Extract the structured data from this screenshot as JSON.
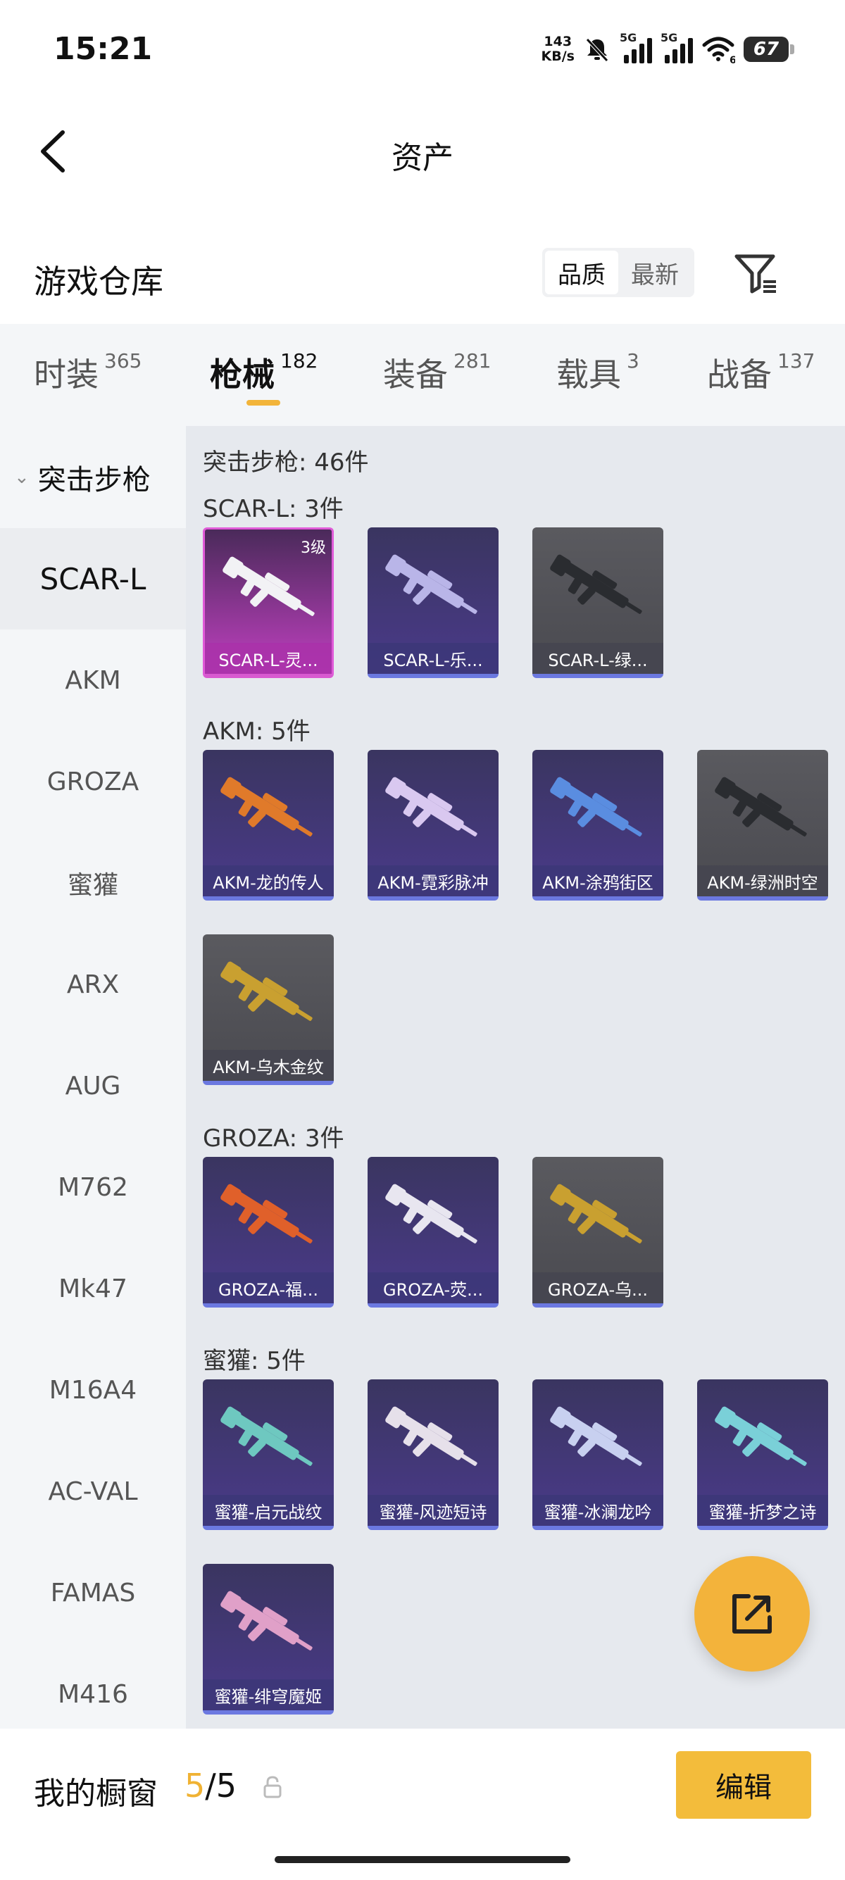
{
  "status_bar": {
    "time": "15:21",
    "net_speed_value": "143",
    "net_speed_unit": "KB/s",
    "signal_1_label": "5G",
    "signal_2_label": "5G",
    "wifi_label": "6",
    "battery": "67"
  },
  "header": {
    "title": "资产"
  },
  "warehouse": {
    "title": "游戏仓库",
    "sort_options": [
      "品质",
      "最新"
    ],
    "active_sort": "品质"
  },
  "tabs": [
    {
      "label": "时装",
      "count": "365"
    },
    {
      "label": "枪械",
      "count": "182"
    },
    {
      "label": "装备",
      "count": "281"
    },
    {
      "label": "载具",
      "count": "3"
    },
    {
      "label": "战备",
      "count": "137"
    }
  ],
  "active_tab": "枪械",
  "sidebar": {
    "category": "突击步枪",
    "items": [
      "SCAR-L",
      "AKM",
      "GROZA",
      "蜜獾",
      "ARX",
      "AUG",
      "M762",
      "Mk47",
      "M16A4",
      "AC-VAL",
      "FAMAS",
      "M416"
    ],
    "active": "SCAR-L"
  },
  "content": {
    "total": "突击步枪: 46件",
    "groups": [
      {
        "label": "SCAR-L: 3件",
        "cards": [
          {
            "name": "SCAR-L-灵...",
            "level": "3级",
            "style": "pink",
            "gun_color": "#f2f2f5"
          },
          {
            "name": "SCAR-L-乐...",
            "style": "purple",
            "gun_color": "#b9b5e8"
          },
          {
            "name": "SCAR-L-绿...",
            "style": "grey",
            "gun_color": "#2a2c30"
          }
        ]
      },
      {
        "label": "AKM: 5件",
        "cards": [
          {
            "name": "AKM-龙的传人",
            "style": "purple",
            "gun_color": "#e07a2a"
          },
          {
            "name": "AKM-霓彩脉冲",
            "style": "purple",
            "gun_color": "#d9c8f0"
          },
          {
            "name": "AKM-涂鸦街区",
            "style": "purple",
            "gun_color": "#5a8de0"
          },
          {
            "name": "AKM-绿洲时空",
            "style": "grey",
            "gun_color": "#2a2c30"
          },
          {
            "name": "AKM-乌木金纹",
            "style": "grey",
            "gun_color": "#c9a030"
          }
        ]
      },
      {
        "label": "GROZA: 3件",
        "cards": [
          {
            "name": "GROZA-福...",
            "style": "purple",
            "gun_color": "#e0602a"
          },
          {
            "name": "GROZA-荧...",
            "style": "purple",
            "gun_color": "#e8e6f0"
          },
          {
            "name": "GROZA-乌...",
            "style": "grey",
            "gun_color": "#c9a030"
          }
        ]
      },
      {
        "label": "蜜獾: 5件",
        "cards": [
          {
            "name": "蜜獾-启元战纹",
            "style": "purple",
            "gun_color": "#6ec8c0"
          },
          {
            "name": "蜜獾-风迹短诗",
            "style": "purple",
            "gun_color": "#e6e0ea"
          },
          {
            "name": "蜜獾-冰澜龙吟",
            "style": "purple",
            "gun_color": "#c8d0f0"
          },
          {
            "name": "蜜獾-折梦之诗",
            "style": "purple",
            "gun_color": "#7ad0d8"
          },
          {
            "name": "蜜獾-绯穹魔姬",
            "style": "purple",
            "gun_color": "#e0a0c8"
          }
        ]
      }
    ]
  },
  "showcase": {
    "label": "我的橱窗",
    "current": "5",
    "separator": "/5"
  },
  "edit_label": "编辑",
  "colors": {
    "accent": "#f3bc3b",
    "pink_card": "#c040c0",
    "purple_card": "#4a3a8a"
  }
}
